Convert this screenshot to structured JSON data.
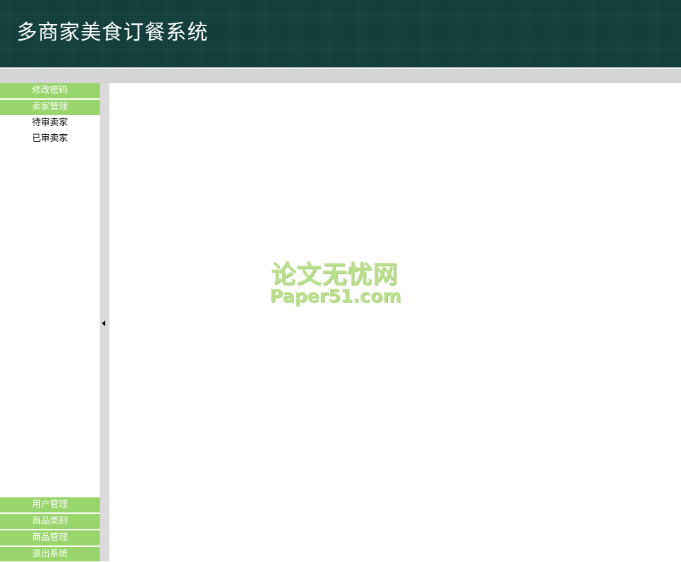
{
  "header": {
    "title": "多商家美食订餐系统"
  },
  "sidebar": {
    "top_items": [
      {
        "label": "修改密码"
      },
      {
        "label": "卖家管理",
        "expanded": true,
        "children": [
          {
            "label": "待审卖家"
          },
          {
            "label": "已审卖家"
          }
        ]
      }
    ],
    "bottom_items": [
      {
        "label": "用户管理"
      },
      {
        "label": "商品类别"
      },
      {
        "label": "商品管理"
      },
      {
        "label": "退出系统"
      }
    ]
  },
  "watermark": {
    "line1": "论文无忧网",
    "line2": "Paper51.com"
  },
  "colors": {
    "header_bg": "#0e3b38",
    "menu_head_bg": "#98d56a",
    "gray_bar": "#d5d5d5"
  },
  "icons": {
    "splitter_toggle": "triangle-left-icon"
  }
}
